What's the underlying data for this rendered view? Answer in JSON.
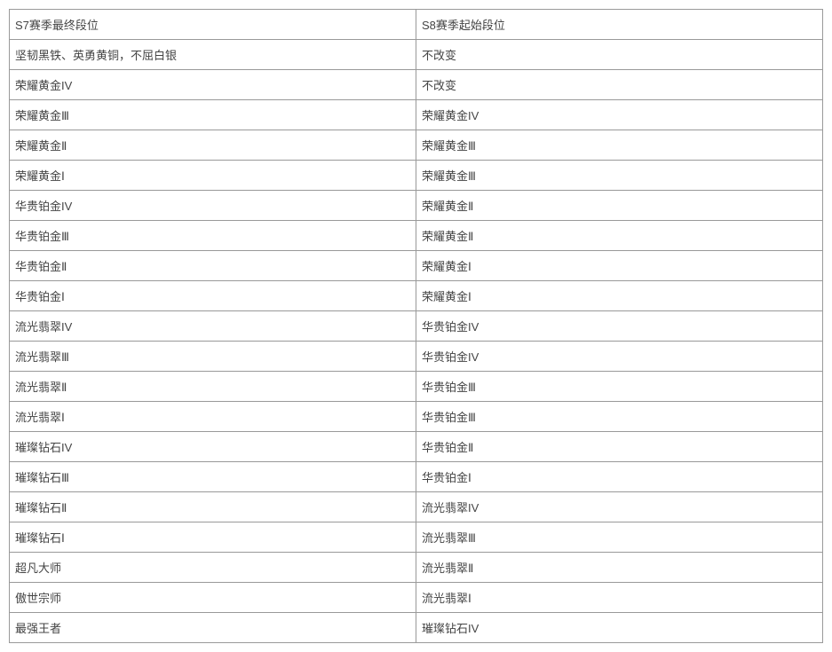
{
  "table": {
    "header": {
      "col1": "S7赛季最终段位",
      "col2": "S8赛季起始段位"
    },
    "rows": [
      {
        "col1": "坚韧黑铁、英勇黄铜，不屈白银",
        "col2": "不改变"
      },
      {
        "col1": "荣耀黄金IV",
        "col2": "不改变"
      },
      {
        "col1": "荣耀黄金Ⅲ",
        "col2": "荣耀黄金IV"
      },
      {
        "col1": "荣耀黄金Ⅱ",
        "col2": "荣耀黄金Ⅲ"
      },
      {
        "col1": "荣耀黄金Ⅰ",
        "col2": "荣耀黄金Ⅲ"
      },
      {
        "col1": "华贵铂金IV",
        "col2": "荣耀黄金Ⅱ"
      },
      {
        "col1": "华贵铂金Ⅲ",
        "col2": "荣耀黄金Ⅱ"
      },
      {
        "col1": "华贵铂金Ⅱ",
        "col2": "荣耀黄金Ⅰ"
      },
      {
        "col1": "华贵铂金Ⅰ",
        "col2": "荣耀黄金Ⅰ"
      },
      {
        "col1": "流光翡翠IV",
        "col2": "华贵铂金IV"
      },
      {
        "col1": "流光翡翠Ⅲ",
        "col2": "华贵铂金IV"
      },
      {
        "col1": "流光翡翠Ⅱ",
        "col2": "华贵铂金Ⅲ"
      },
      {
        "col1": "流光翡翠Ⅰ",
        "col2": "华贵铂金Ⅲ"
      },
      {
        "col1": "璀璨钻石IV",
        "col2": "华贵铂金Ⅱ"
      },
      {
        "col1": "璀璨钻石Ⅲ",
        "col2": "华贵铂金Ⅰ"
      },
      {
        "col1": "璀璨钻石Ⅱ",
        "col2": "流光翡翠IV"
      },
      {
        "col1": "璀璨钻石Ⅰ",
        "col2": "流光翡翠Ⅲ"
      },
      {
        "col1": "超凡大师",
        "col2": "流光翡翠Ⅱ"
      },
      {
        "col1": "傲世宗师",
        "col2": "流光翡翠Ⅰ"
      },
      {
        "col1": "最强王者",
        "col2": "璀璨钻石IV"
      }
    ]
  }
}
